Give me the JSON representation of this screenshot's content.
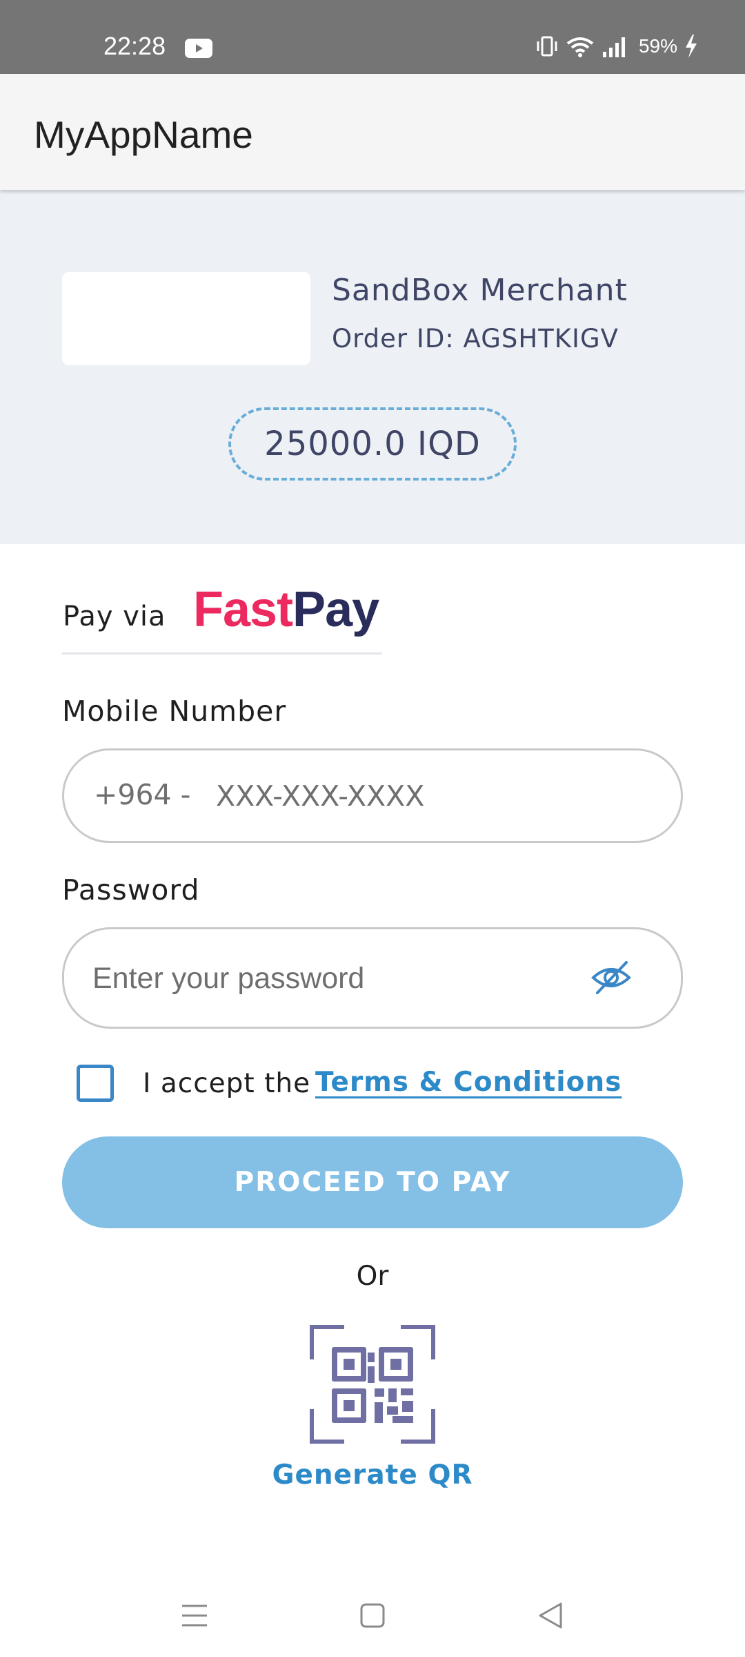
{
  "status_bar": {
    "time": "22:28",
    "battery": "59%",
    "icons": [
      "youtube-icon",
      "vibrate-icon",
      "wifi-icon",
      "signal-icon",
      "charging-icon"
    ]
  },
  "app_bar": {
    "title": "MyAppName"
  },
  "merchant": {
    "name": "SandBox Merchant",
    "order_id": "Order ID: AGSHTKIGV",
    "amount": "25000.0 IQD"
  },
  "pay_via": {
    "label": "Pay via",
    "brand_fast": "Fast",
    "brand_pay": "Pay"
  },
  "form": {
    "mobile_label": "Mobile Number",
    "mobile_prefix": "+964  -",
    "mobile_placeholder": "XXX-XXX-XXXX",
    "password_label": "Password",
    "password_placeholder": "Enter your password",
    "accept_text": "I accept the",
    "terms_link": "Terms & Conditions",
    "proceed_label": "PROCEED TO PAY",
    "or_text": "Or",
    "generate_qr_label": "Generate QR"
  },
  "colors": {
    "accent": "#2d8ac8",
    "button": "#84bfe6",
    "brand_fast": "#ec2a5f",
    "brand_pay": "#2a2d5c",
    "panel_bg": "#edf1f6"
  },
  "nav_bar": {
    "icons": [
      "menu-icon",
      "home-icon",
      "back-icon"
    ]
  }
}
